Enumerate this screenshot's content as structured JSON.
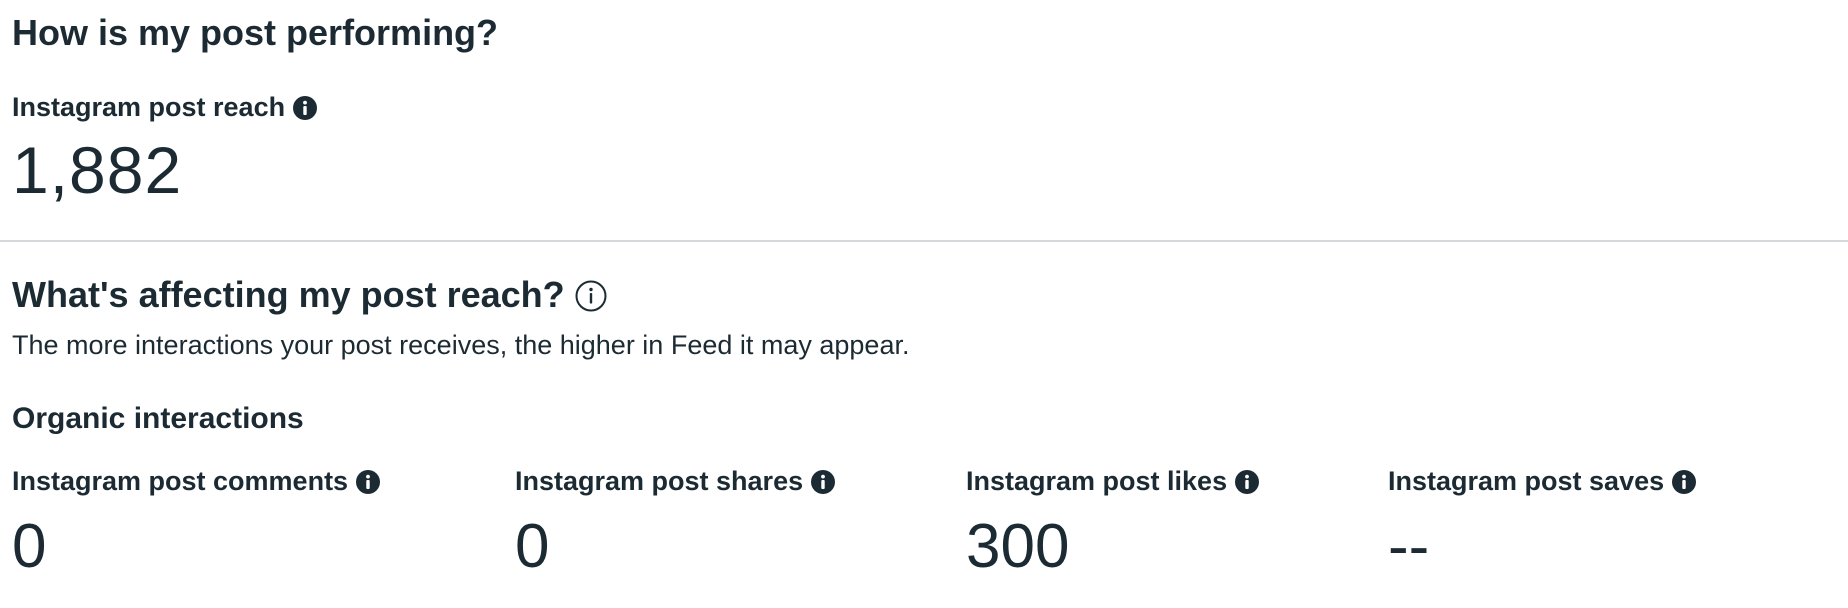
{
  "performance": {
    "title": "How is my post performing?",
    "reach_label": "Instagram post reach",
    "reach_value": "1,882"
  },
  "reach_factors": {
    "title": "What's affecting my post reach?",
    "description": "The more interactions your post receives, the higher in Feed it may appear.",
    "info_icon": "info-outline-icon"
  },
  "organic": {
    "title": "Organic interactions",
    "metrics": [
      {
        "label": "Instagram post comments",
        "value": "0",
        "icon": "info-filled-icon"
      },
      {
        "label": "Instagram post shares",
        "value": "0",
        "icon": "info-filled-icon"
      },
      {
        "label": "Instagram post likes",
        "value": "300",
        "icon": "info-filled-icon"
      },
      {
        "label": "Instagram post saves",
        "value": "--",
        "icon": "info-filled-icon"
      }
    ]
  },
  "colors": {
    "text": "#1c2b33",
    "divider": "#d5d9dc"
  }
}
